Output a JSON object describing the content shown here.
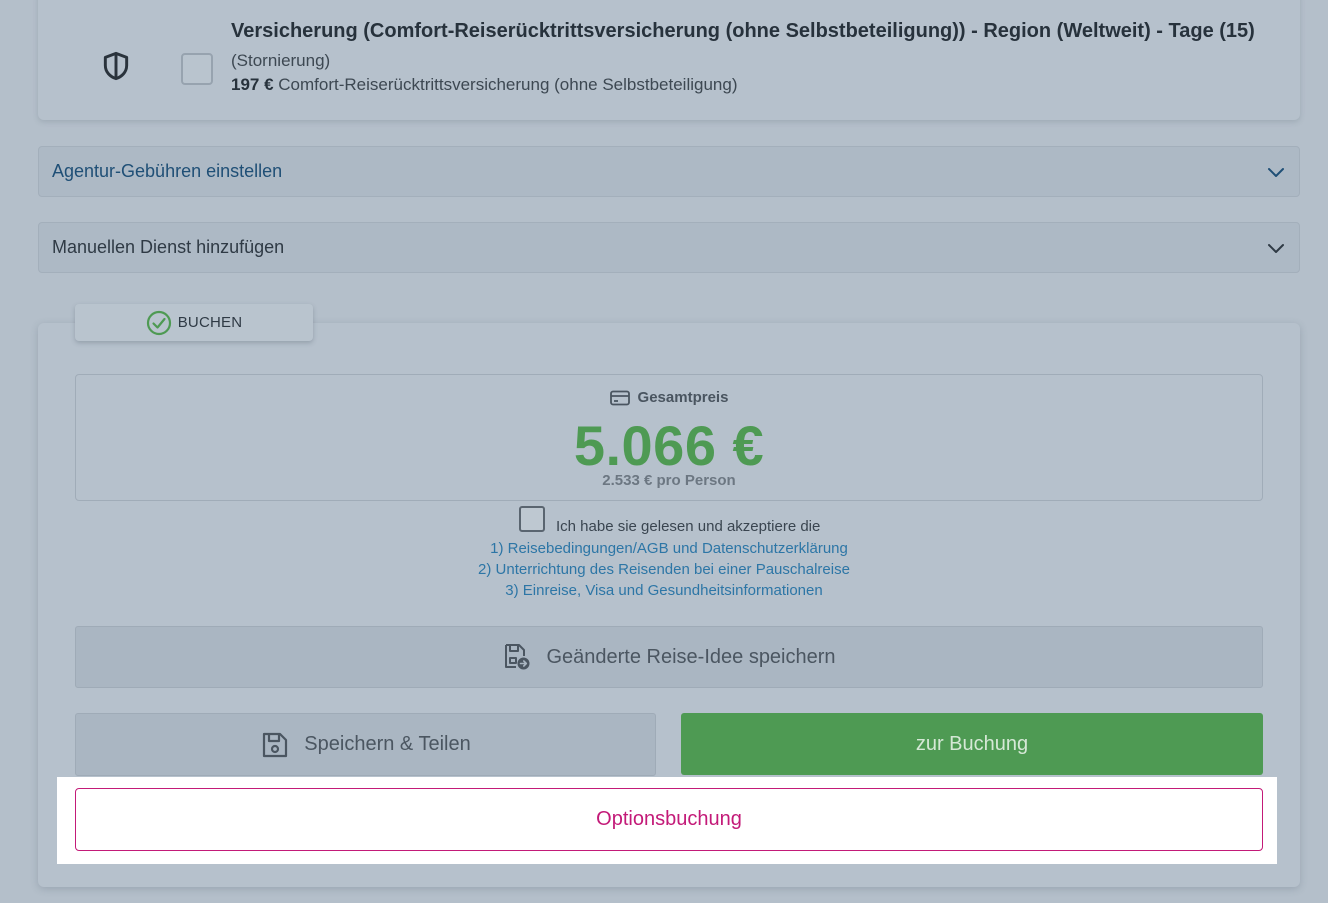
{
  "insurance": {
    "icon": "shield-icon",
    "title": "Versicherung (Comfort-Reiserücktrittsversicherung (ohne Selbstbeteiligung)) - Region (Weltweit) - Tage (15)",
    "subtitle": "(Stornierung)",
    "price": "197 €",
    "description": "Comfort-Reiserücktrittsversicherung (ohne Selbstbeteiligung)",
    "checked": false
  },
  "accordions": [
    {
      "label": "Agentur-Gebühren einstellen"
    },
    {
      "label": "Manuellen Dienst hinzufügen"
    }
  ],
  "booking": {
    "tab_label": "BUCHEN",
    "price_label": "Gesamtpreis",
    "total": "5.066 €",
    "per_person": "2.533 € pro Person",
    "terms_intro": "Ich habe sie gelesen und akzeptiere die",
    "terms_links": [
      "1) Reisebedingungen/AGB und Datenschutzerklärung",
      "2) Unterrichtung des Reisenden bei einer Pauschalreise",
      "3) Einreise, Visa und Gesundheitsinformationen"
    ],
    "terms_checked": false,
    "save_idea_label": "Geänderte Reise-Idee speichern",
    "share_label": "Speichern & Teilen",
    "book_label": "zur Buchung",
    "option_label": "Optionsbuchung"
  },
  "colors": {
    "accent_green": "#4e9a53",
    "option_magenta": "#c31a78",
    "link_blue": "#2d76a6"
  }
}
